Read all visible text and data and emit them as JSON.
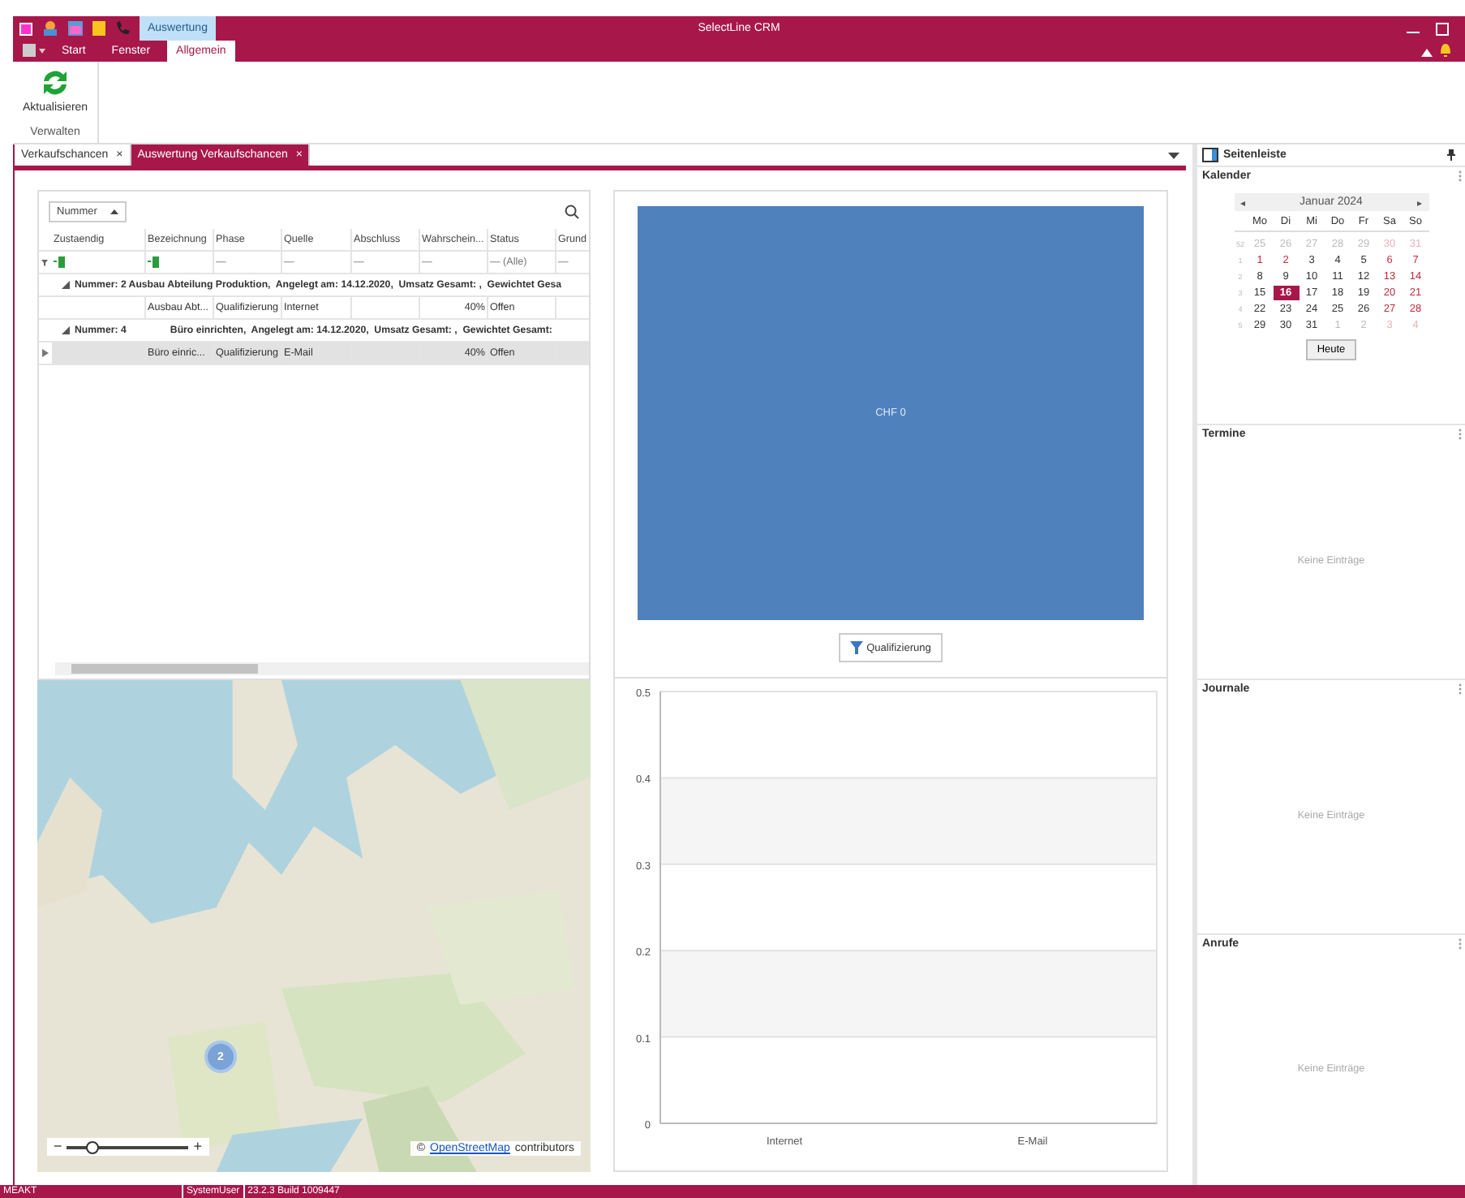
{
  "window": {
    "title": "SelectLine CRM"
  },
  "context_tab": {
    "label": "Auswertung"
  },
  "ribbon_tabs": [
    {
      "label": "Start",
      "selected": false
    },
    {
      "label": "Fenster",
      "selected": false
    },
    {
      "label": "Allgemein",
      "selected": true
    }
  ],
  "ribbon": {
    "button": "Aktualisieren",
    "group": "Verwalten"
  },
  "doc_tabs": [
    {
      "label": "Verkaufschancen",
      "selected": false,
      "close": "×"
    },
    {
      "label": "Auswertung Verkaufschancen",
      "selected": true,
      "close": "×"
    }
  ],
  "grid": {
    "group_by": "Nummer",
    "columns": [
      "Zustaendig",
      "Bezeichnung",
      "Phase",
      "Quelle",
      "Abschluss",
      "Wahrschein...",
      "Status",
      "Grund"
    ],
    "filter": [
      {
        "kind": "icon"
      },
      {
        "kind": "icon"
      },
      {
        "kind": "text",
        "text": "—"
      },
      {
        "kind": "text",
        "text": "—"
      },
      {
        "kind": "text",
        "text": "—"
      },
      {
        "kind": "text",
        "text": "—"
      },
      {
        "kind": "text",
        "text": "—  (Alle)"
      },
      {
        "kind": "text",
        "text": "—"
      }
    ],
    "rows": [
      {
        "kind": "group",
        "text": "Nummer: 2 Ausbau Abteilung Produktion,  Angelegt am: 14.12.2020,  Umsatz Gesamt: ,  Gewichtet Gesa"
      },
      {
        "kind": "row",
        "cells": [
          "",
          "Ausbau Abt...",
          "Qualifizierung",
          "Internet",
          "",
          "40%",
          "Offen",
          ""
        ],
        "selected": false
      },
      {
        "kind": "group",
        "text": "Nummer: 4                Büro einrichten,  Angelegt am: 14.12.2020,  Umsatz Gesamt: ,  Gewichtet Gesamt:"
      },
      {
        "kind": "row",
        "cells": [
          "",
          "Büro einric...",
          "Qualifizierung",
          "E-Mail",
          "",
          "40%",
          "Offen",
          ""
        ],
        "selected": true
      }
    ]
  },
  "map": {
    "kind": "picture",
    "marker": "2",
    "attribution_prefix": "©",
    "attribution_link": "OpenStreetMap",
    "attribution_suffix": "contributors",
    "zoom_minus": "−",
    "zoom_plus": "+",
    "level": 0.15
  },
  "top_chart": {
    "block_label": "CHF 0",
    "filter_button": "Qualifizierung"
  },
  "bar_chart": {
    "chart_data": {
      "type": "bar",
      "categories": [
        "Internet",
        "E-Mail"
      ],
      "values": [
        0,
        0
      ],
      "grid": true,
      "ylim": [
        0,
        0.5
      ],
      "yticks": [
        0,
        0.1,
        0.2,
        0.3,
        0.4,
        0.5
      ]
    }
  },
  "sidebar": {
    "title": "Seitenleiste",
    "sections": [
      {
        "title": "Kalender",
        "kind": "calendar"
      },
      {
        "title": "Termine",
        "kind": "list",
        "empty": "Keine Einträge"
      },
      {
        "title": "Journale",
        "kind": "list",
        "empty": "Keine Einträge"
      },
      {
        "title": "Anrufe",
        "kind": "list",
        "empty": "Keine Einträge"
      }
    ]
  },
  "calendar": {
    "month": "Januar 2024",
    "prev": "◂",
    "next": "▸",
    "weekdays": [
      "Mo",
      "Di",
      "Mi",
      "Do",
      "Fr",
      "Sa",
      "So"
    ],
    "today_button": "Heute",
    "weeks": [
      {
        "number": "52",
        "days": [
          {
            "d": "25",
            "other": true,
            "weekend": false,
            "selected": false
          },
          {
            "d": "26",
            "other": true,
            "weekend": false,
            "selected": false
          },
          {
            "d": "27",
            "other": true,
            "weekend": false,
            "selected": false
          },
          {
            "d": "28",
            "other": true,
            "weekend": false,
            "selected": false
          },
          {
            "d": "29",
            "other": true,
            "weekend": false,
            "selected": false
          },
          {
            "d": "30",
            "other": true,
            "weekend": true,
            "selected": false
          },
          {
            "d": "31",
            "other": true,
            "weekend": true,
            "selected": false
          }
        ]
      },
      {
        "number": "1",
        "days": [
          {
            "d": "1",
            "other": false,
            "weekend": true,
            "selected": false
          },
          {
            "d": "2",
            "other": false,
            "weekend": true,
            "selected": false
          },
          {
            "d": "3",
            "other": false,
            "weekend": false,
            "selected": false
          },
          {
            "d": "4",
            "other": false,
            "weekend": false,
            "selected": false
          },
          {
            "d": "5",
            "other": false,
            "weekend": false,
            "selected": false
          },
          {
            "d": "6",
            "other": false,
            "weekend": true,
            "selected": false
          },
          {
            "d": "7",
            "other": false,
            "weekend": true,
            "selected": false
          }
        ]
      },
      {
        "number": "2",
        "days": [
          {
            "d": "8",
            "other": false,
            "weekend": false,
            "selected": false
          },
          {
            "d": "9",
            "other": false,
            "weekend": false,
            "selected": false
          },
          {
            "d": "10",
            "other": false,
            "weekend": false,
            "selected": false
          },
          {
            "d": "11",
            "other": false,
            "weekend": false,
            "selected": false
          },
          {
            "d": "12",
            "other": false,
            "weekend": false,
            "selected": false
          },
          {
            "d": "13",
            "other": false,
            "weekend": true,
            "selected": false
          },
          {
            "d": "14",
            "other": false,
            "weekend": true,
            "selected": false
          }
        ]
      },
      {
        "number": "3",
        "days": [
          {
            "d": "15",
            "other": false,
            "weekend": false,
            "selected": false
          },
          {
            "d": "16",
            "other": false,
            "weekend": false,
            "selected": true
          },
          {
            "d": "17",
            "other": false,
            "weekend": false,
            "selected": false
          },
          {
            "d": "18",
            "other": false,
            "weekend": false,
            "selected": false
          },
          {
            "d": "19",
            "other": false,
            "weekend": false,
            "selected": false
          },
          {
            "d": "20",
            "other": false,
            "weekend": true,
            "selected": false
          },
          {
            "d": "21",
            "other": false,
            "weekend": true,
            "selected": false
          }
        ]
      },
      {
        "number": "4",
        "days": [
          {
            "d": "22",
            "other": false,
            "weekend": false,
            "selected": false
          },
          {
            "d": "23",
            "other": false,
            "weekend": false,
            "selected": false
          },
          {
            "d": "24",
            "other": false,
            "weekend": false,
            "selected": false
          },
          {
            "d": "25",
            "other": false,
            "weekend": false,
            "selected": false
          },
          {
            "d": "26",
            "other": false,
            "weekend": false,
            "selected": false
          },
          {
            "d": "27",
            "other": false,
            "weekend": true,
            "selected": false
          },
          {
            "d": "28",
            "other": false,
            "weekend": true,
            "selected": false
          }
        ]
      },
      {
        "number": "5",
        "days": [
          {
            "d": "29",
            "other": false,
            "weekend": false,
            "selected": false
          },
          {
            "d": "30",
            "other": false,
            "weekend": false,
            "selected": false
          },
          {
            "d": "31",
            "other": false,
            "weekend": false,
            "selected": false
          },
          {
            "d": "1",
            "other": true,
            "weekend": false,
            "selected": false
          },
          {
            "d": "2",
            "other": true,
            "weekend": false,
            "selected": false
          },
          {
            "d": "3",
            "other": true,
            "weekend": true,
            "selected": false
          },
          {
            "d": "4",
            "other": true,
            "weekend": true,
            "selected": false
          }
        ]
      }
    ]
  },
  "status_bar": [
    "MEAKT",
    "SystemUser",
    "23.2.3 Build 1009447"
  ]
}
